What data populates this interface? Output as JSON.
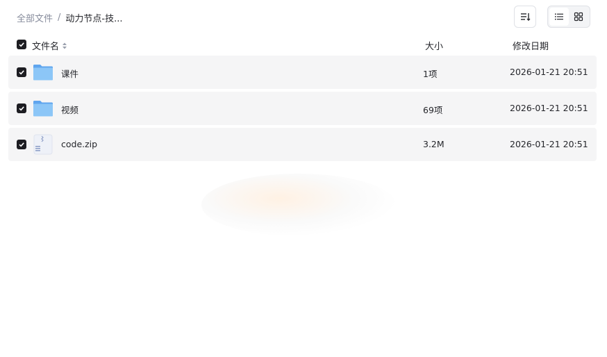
{
  "breadcrumb": {
    "root": "全部文件",
    "separator": "/",
    "current": "动力节点-技..."
  },
  "toolbar": {
    "sort_icon": "sort-lines-icon",
    "view_list_icon": "list-view-icon",
    "view_grid_icon": "grid-view-icon",
    "active_view": "list"
  },
  "table": {
    "select_all_checked": true,
    "headers": {
      "name": "文件名",
      "size": "大小",
      "date": "修改日期"
    },
    "rows": [
      {
        "icon": "folder-icon",
        "name": "课件",
        "size": "1项",
        "date": "2026-01-21 20:51",
        "checked": true
      },
      {
        "icon": "folder-icon",
        "name": "视频",
        "size": "69项",
        "date": "2026-01-21 20:51",
        "checked": true
      },
      {
        "icon": "zip-file-icon",
        "name": "code.zip",
        "size": "3.2M",
        "date": "2026-01-21 20:51",
        "checked": true
      }
    ]
  },
  "colors": {
    "row_bg": "#f5f5f6",
    "checkbox": "#1d1d22",
    "folder_blue": "#7ab8f5",
    "muted_text": "#878c9c"
  }
}
